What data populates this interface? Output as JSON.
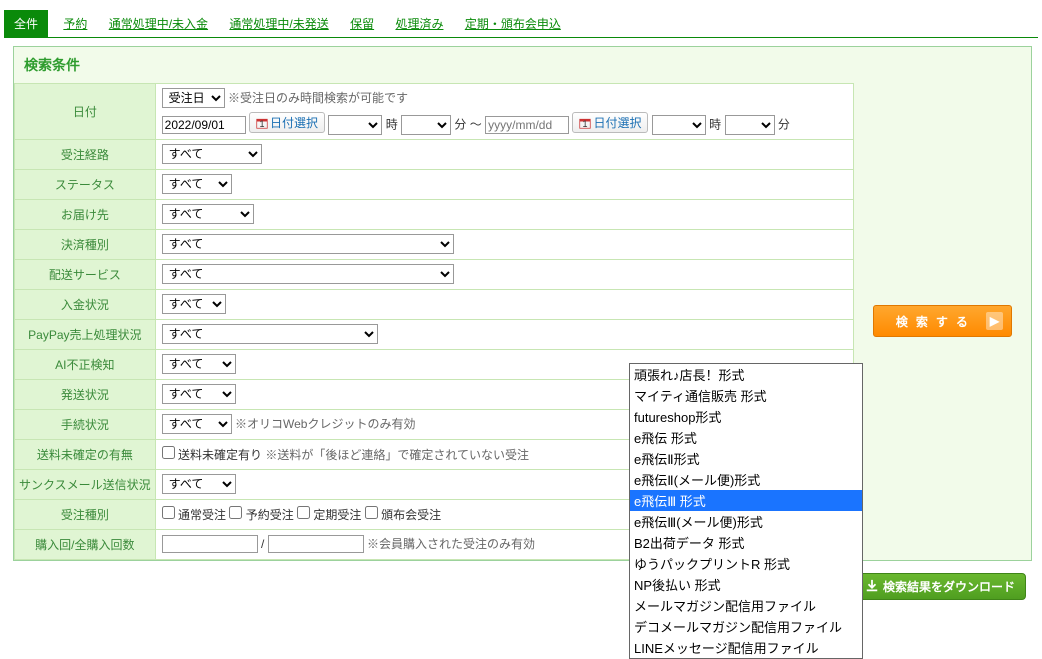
{
  "tabs": {
    "active": "全件",
    "items": [
      "予約",
      "通常処理中/未入金",
      "通常処理中/未発送",
      "保留",
      "処理済み",
      "定期・頒布会申込"
    ]
  },
  "panel_title": "検索条件",
  "labels": {
    "date": "日付",
    "route": "受注経路",
    "status": "ステータス",
    "dest": "お届け先",
    "payment": "決済種別",
    "shipping": "配送サービス",
    "paid": "入金状況",
    "paypay": "PayPay売上処理状況",
    "ai": "AI不正検知",
    "shipstat": "発送状況",
    "proc": "手続状況",
    "freight": "送料未確定の有無",
    "thanks": "サンクスメール送信状況",
    "ordertype": "受注種別",
    "count": "購入回/全購入回数"
  },
  "date": {
    "kind": "受注日",
    "note1": "※受注日のみ時間検索が可能です",
    "from": "2022/09/01",
    "to_ph": "yyyy/mm/dd",
    "cal": "日付選択",
    "ji": "時",
    "fun": "分",
    "sep": "～"
  },
  "all": "すべて",
  "proc_note": "※オリコWebクレジットのみ有効",
  "freight_chk": "送料未確定有り",
  "freight_note": "※送料が「後ほど連絡」で確定されていない受注",
  "ordertype_opts": {
    "normal": "通常受注",
    "reserve": "予約受注",
    "period": "定期受注",
    "hanpu": "頒布会受注"
  },
  "count_sep": "/",
  "count_note": "※会員購入された受注のみ有効",
  "btn": {
    "search": "検索する",
    "download": "検索結果をダウンロード"
  },
  "format_select": "頑張れ♪店長！形式",
  "dropdown": [
    "頑張れ♪店長！形式",
    "マイティ通信販売 形式",
    "futureshop形式",
    "e飛伝 形式",
    "e飛伝Ⅱ形式",
    "e飛伝Ⅱ(メール便)形式",
    "e飛伝Ⅲ 形式",
    "e飛伝Ⅲ(メール便)形式",
    "B2出荷データ 形式",
    "ゆうパックプリントR 形式",
    "NP後払い 形式",
    "メールマガジン配信用ファイル",
    "デコメールマガジン配信用ファイル",
    "LINEメッセージ配信用ファイル"
  ],
  "dropdown_selected_index": 6
}
